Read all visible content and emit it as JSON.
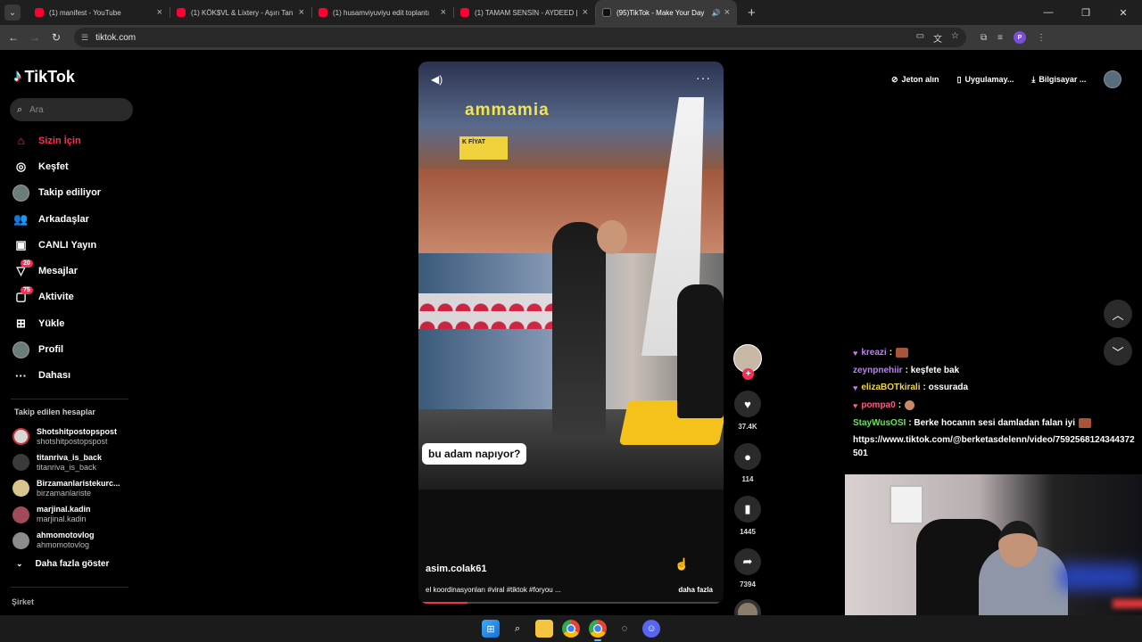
{
  "browser": {
    "tabs": [
      {
        "title": "(1) manifest - YouTube",
        "favicon": "youtube-icon",
        "active": false
      },
      {
        "title": "(1) KÖK$VL & Lixtery - Aşırı Tan",
        "favicon": "youtube-icon",
        "active": false
      },
      {
        "title": "(1) husamviyuviyu edit toplantı",
        "favicon": "youtube-icon",
        "active": false
      },
      {
        "title": "(1) TAMAM SENSİN - AYDEED |",
        "favicon": "youtube-icon",
        "active": false
      },
      {
        "title": "(95)TikTok - Make Your Day",
        "favicon": "tiktok-icon",
        "active": true
      }
    ],
    "url": "tiktok.com",
    "profile_initial": "P"
  },
  "sidebar": {
    "logo": "TikTok",
    "search_placeholder": "Ara",
    "menu": [
      {
        "label": "Sizin İçin",
        "icon": "home-icon",
        "active": true
      },
      {
        "label": "Keşfet",
        "icon": "compass-icon"
      },
      {
        "label": "Takip ediliyor",
        "icon": "following-avatar-icon"
      },
      {
        "label": "Arkadaşlar",
        "icon": "friends-icon"
      },
      {
        "label": "CANLI Yayın",
        "icon": "live-icon"
      },
      {
        "label": "Mesajlar",
        "icon": "message-icon",
        "badge": "20"
      },
      {
        "label": "Aktivite",
        "icon": "activity-icon",
        "badge": "75"
      },
      {
        "label": "Yükle",
        "icon": "upload-icon"
      },
      {
        "label": "Profil",
        "icon": "profile-avatar-icon"
      },
      {
        "label": "Dahası",
        "icon": "more-icon"
      }
    ],
    "following_title": "Takip edilen hesaplar",
    "following": [
      {
        "name": "Shotshitpostopspost",
        "handle": "shotshitpostopspost"
      },
      {
        "name": "titanriva_is_back",
        "handle": "titanriva_is_back"
      },
      {
        "name": "Birzamanlaristekurc...",
        "handle": "birzamanlariste"
      },
      {
        "name": "marjinal.kadin",
        "handle": "marjinal.kadin"
      },
      {
        "name": "ahmomotovlog",
        "handle": "ahmomotovlog"
      }
    ],
    "show_more": "Daha fazla göster",
    "company": "Şirket"
  },
  "header": {
    "coins": "Jeton alın",
    "app": "Uygulamay...",
    "desktop": "Bilgisayar ..."
  },
  "video": {
    "store_sign": "ammamia",
    "price_sign": "K FİYAT",
    "caption_overlay": "bu adam napıyor?",
    "author": "asim.colak61",
    "description": "el koordinasyonları #viral #tiktok #foryou ...",
    "more": "daha fazla",
    "progress": 0.16
  },
  "actions": {
    "likes": "37.4K",
    "comments": "114",
    "saves": "1445",
    "shares": "7394"
  },
  "chat": {
    "messages": [
      {
        "user": "kreazi",
        "text": "",
        "color": "#c47cff",
        "heart": true,
        "emote": true
      },
      {
        "user": "zeynpnehiir",
        "text": "keşfete bak",
        "color": "#c47cff",
        "heart": false,
        "emote": false
      },
      {
        "user": "elizaBOTkirali",
        "text": "ossurada",
        "color": "#f0d84a",
        "heart": true,
        "emote": false
      },
      {
        "user": "pompa0",
        "text": "",
        "color": "#ff5a8a",
        "heart": true,
        "emote": true
      },
      {
        "user": "StayWusOSI",
        "text": "Berke hocanın sesi damladan falan iyi",
        "color": "#67e35a",
        "heart": false,
        "emote": true
      }
    ],
    "link": "https://www.tiktok.com/@berketasdelenn/video/7592568124344372501"
  },
  "colors": {
    "accent": "#fe2c55",
    "background": "#000000"
  }
}
